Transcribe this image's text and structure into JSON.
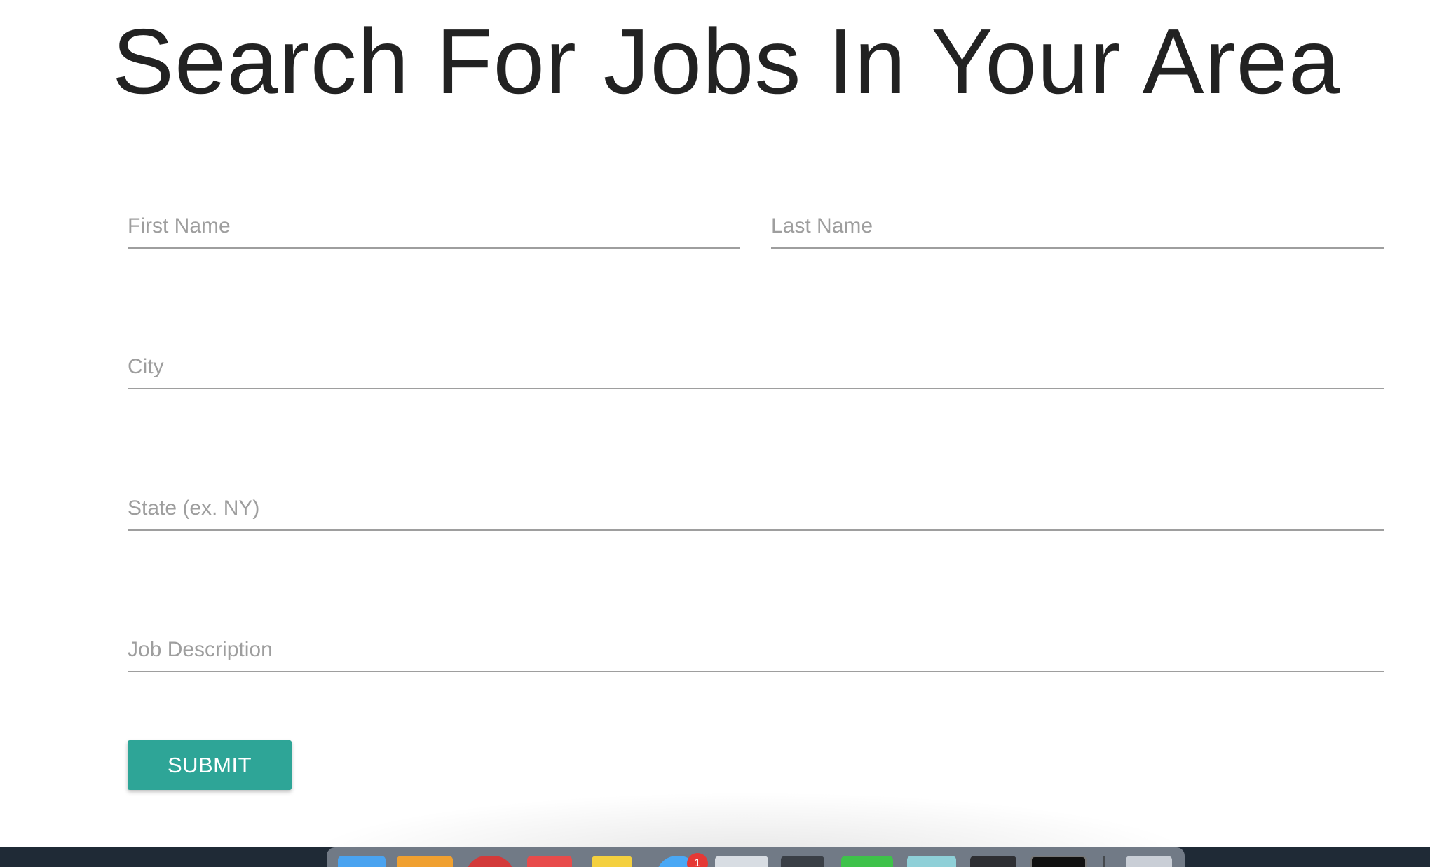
{
  "page": {
    "title": "Search For Jobs In Your Area"
  },
  "form": {
    "first_name": {
      "placeholder": "First Name",
      "value": ""
    },
    "last_name": {
      "placeholder": "Last Name",
      "value": ""
    },
    "city": {
      "placeholder": "City",
      "value": ""
    },
    "state": {
      "placeholder": "State (ex. NY)",
      "value": ""
    },
    "job_description": {
      "placeholder": "Job Description",
      "value": ""
    },
    "submit_label": "SUBMIT"
  },
  "colors": {
    "accent": "#2ea597",
    "title": "#222222",
    "placeholder": "#9e9e9e",
    "underline": "#9e9e9e"
  },
  "dock": {
    "apps": [
      {
        "name": "finder-icon"
      },
      {
        "name": "pages-icon"
      },
      {
        "name": "chrome-icon"
      },
      {
        "name": "calendar-icon"
      },
      {
        "name": "notes-icon"
      },
      {
        "name": "messages-icon",
        "badge": "1"
      },
      {
        "name": "clock-icon"
      },
      {
        "name": "numbers-icon"
      },
      {
        "name": "phone-icon"
      },
      {
        "name": "maps-icon"
      },
      {
        "name": "app-icon"
      },
      {
        "name": "terminal-icon"
      },
      {
        "name": "trash-icon"
      }
    ]
  }
}
